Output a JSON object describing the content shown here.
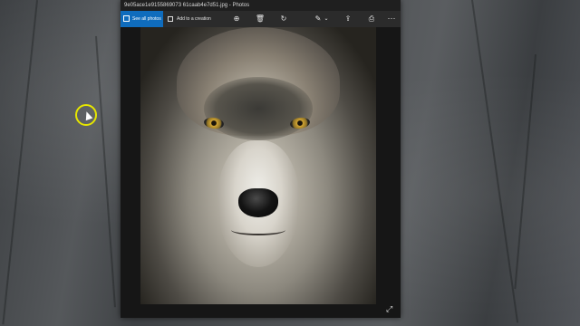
{
  "window": {
    "title": "9e05ace1e9155869073 61caab4e7d51.jpg - Photos"
  },
  "toolbar": {
    "see_all_photos": "See all photos",
    "add_to_creation": "Add to a creation",
    "buttons": [
      "zoom-icon",
      "delete-icon",
      "rotate-icon",
      "edit-icon",
      "share-icon",
      "print-icon",
      "more-icon"
    ]
  },
  "icons": {
    "zoom": "⊕",
    "delete": "🗑",
    "rotate": "↻",
    "edit": "✎",
    "chevron": "⌄",
    "share": "⇪",
    "print": "⎙",
    "more": "···",
    "expand": "⤢"
  },
  "photo": {
    "subject": "wolf"
  }
}
